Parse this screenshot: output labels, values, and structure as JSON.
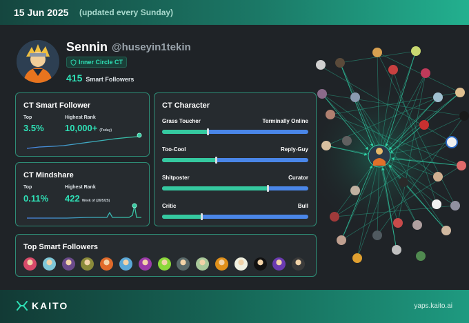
{
  "header": {
    "date": "15 Jun 2025",
    "updated": "(updated every Sunday)"
  },
  "profile": {
    "name": "Sennin",
    "handle": "@huseyin1tekin",
    "badge": "Inner Circle CT",
    "smart_followers_count": "415",
    "smart_followers_label": "Smart Followers"
  },
  "smart_follower_card": {
    "title": "CT Smart Follower",
    "top_label": "Top",
    "top_value": "3.5%",
    "rank_label": "Highest Rank",
    "rank_value": "10,000+",
    "rank_note": "(Today)"
  },
  "mindshare_card": {
    "title": "CT Mindshare",
    "top_label": "Top",
    "top_value": "0.11%",
    "rank_label": "Highest Rank",
    "rank_value": "422",
    "rank_note": "Week of (26/5/25)"
  },
  "character_card": {
    "title": "CT Character",
    "traits": [
      {
        "left": "Grass Toucher",
        "right": "Terminally Online",
        "value": 0.31
      },
      {
        "left": "Too-Cool",
        "right": "Reply-Guy",
        "value": 0.37
      },
      {
        "left": "Shitposter",
        "right": "Curator",
        "value": 0.72
      },
      {
        "left": "Critic",
        "right": "Bull",
        "value": 0.27
      }
    ]
  },
  "top_smart_followers": {
    "title": "Top Smart Followers",
    "avatars": [
      "#d84a6a",
      "#7fc8d8",
      "#6a4a8a",
      "#8a8a3a",
      "#e06a2a",
      "#5aa8d8",
      "#9a3aa8",
      "#8ad83a",
      "#5a6a6a",
      "#a8c89a",
      "#e0901a",
      "#f0f0e0",
      "#111111",
      "#6a3ab0",
      "#3a3a3a"
    ]
  },
  "footer": {
    "brand": "KAITO",
    "site": "yaps.kaito.ai"
  },
  "colors": {
    "accent": "#2fe0b6",
    "bar_blue": "#4a86e8",
    "bar_green": "#35c9a0"
  }
}
